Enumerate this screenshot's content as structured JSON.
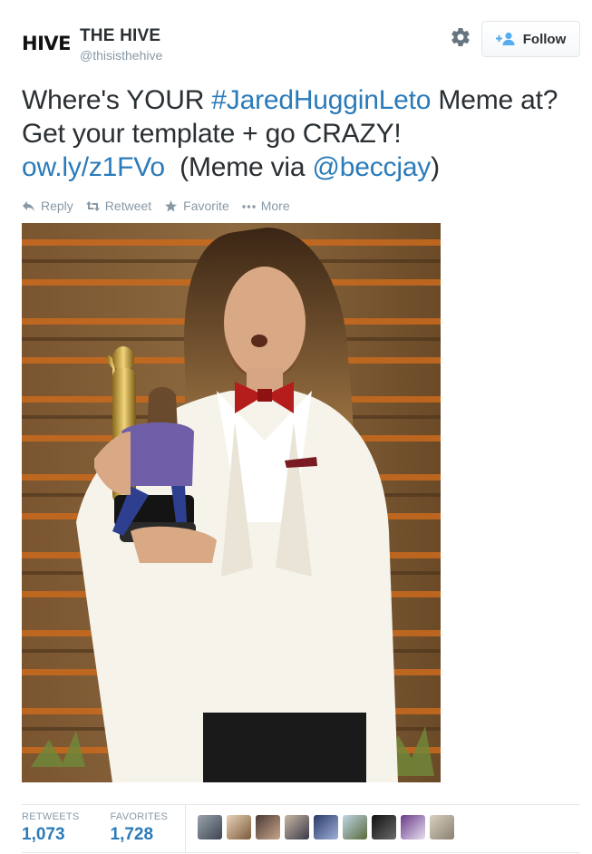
{
  "account": {
    "logo_text": "HIVE",
    "display_name": "THE HIVE",
    "handle": "@thisisthehive"
  },
  "follow_button": {
    "label": "Follow"
  },
  "tweet": {
    "text_1": "Where's YOUR ",
    "hashtag": "#JaredHugginLeto",
    "text_2": " Meme at? Get your template + go CRAZY!",
    "link": "ow.ly/z1FVo",
    "text_3": "  (Meme via ",
    "mention": "@beccjay",
    "text_4": ")"
  },
  "actions": {
    "reply": "Reply",
    "retweet": "Retweet",
    "favorite": "Favorite",
    "more": "More"
  },
  "stats": {
    "retweets_label": "RETWEETS",
    "retweets_value": "1,073",
    "favorites_label": "FAVORITES",
    "favorites_value": "1,728"
  },
  "colors": {
    "link": "#2b7bb9",
    "follow_icon": "#55acee",
    "muted": "#8899a6",
    "text": "#292f33"
  },
  "favoriter_avatars": [
    "avatar-1",
    "avatar-2",
    "avatar-3",
    "avatar-4",
    "avatar-5",
    "avatar-6",
    "avatar-7",
    "avatar-8",
    "avatar-9"
  ]
}
